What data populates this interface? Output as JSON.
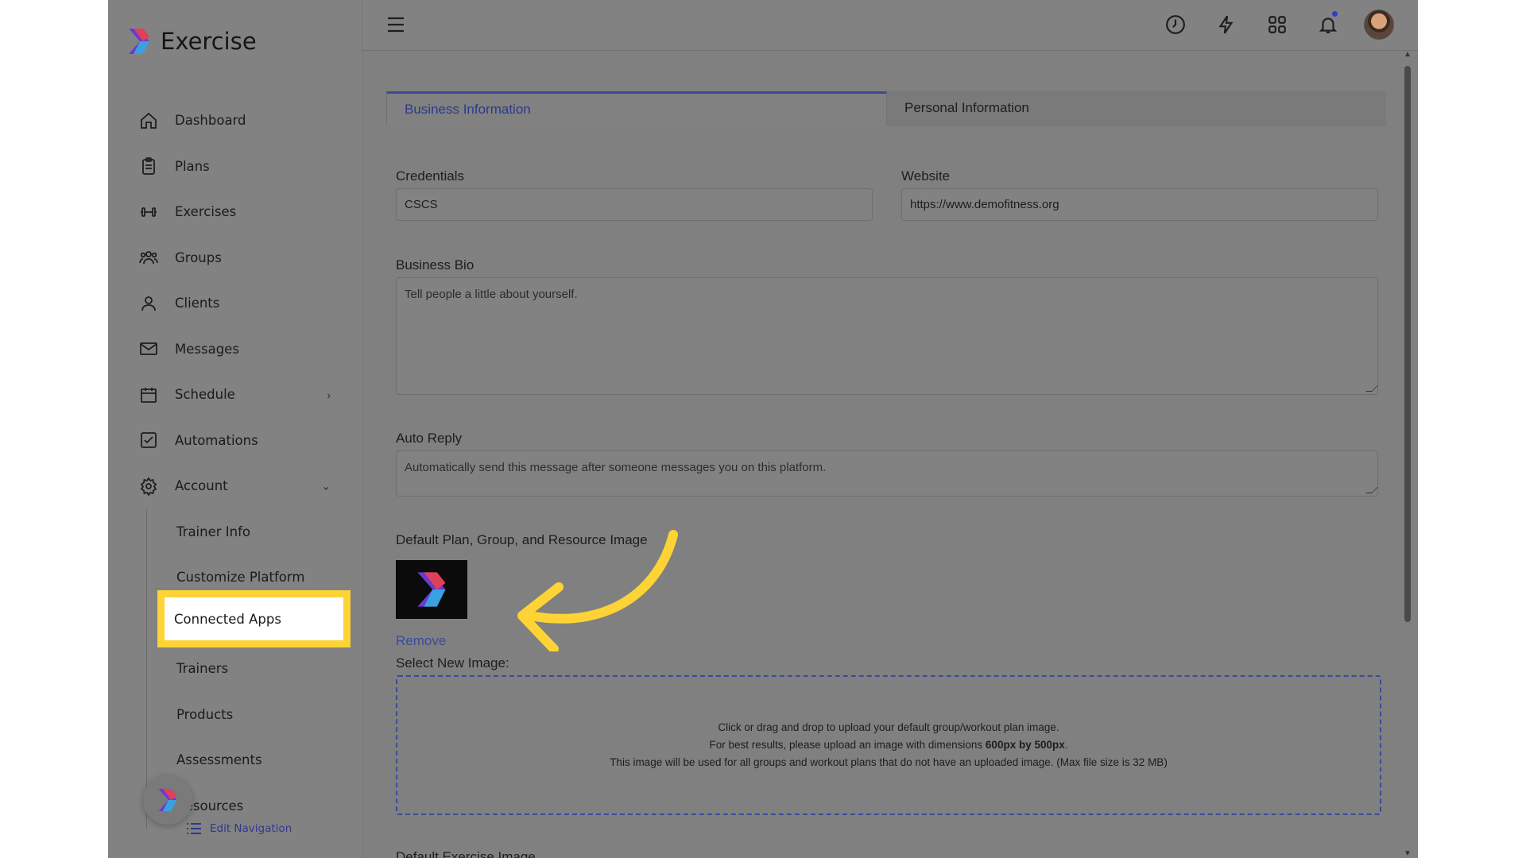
{
  "app": {
    "name": "Exercise"
  },
  "sidebar": {
    "items": [
      {
        "label": "Dashboard",
        "icon": "home-icon"
      },
      {
        "label": "Plans",
        "icon": "clipboard-icon"
      },
      {
        "label": "Exercises",
        "icon": "dumbbell-icon"
      },
      {
        "label": "Groups",
        "icon": "groups-icon"
      },
      {
        "label": "Clients",
        "icon": "user-icon"
      },
      {
        "label": "Messages",
        "icon": "mail-icon"
      },
      {
        "label": "Schedule",
        "icon": "calendar-icon",
        "chevron": "›"
      },
      {
        "label": "Automations",
        "icon": "checkbox-icon"
      },
      {
        "label": "Account",
        "icon": "gear-icon",
        "chevron": "⌄"
      }
    ],
    "account_sub": [
      {
        "label": "Trainer Info"
      },
      {
        "label": "Customize Platform"
      },
      {
        "label": "Connected Apps"
      },
      {
        "label": "Trainers"
      },
      {
        "label": "Products"
      },
      {
        "label": "Assessments"
      },
      {
        "label": "Resources"
      }
    ],
    "edit_navigation": "Edit Navigation"
  },
  "tabs": [
    {
      "label": "Business Information",
      "active": true
    },
    {
      "label": "Personal Information",
      "active": false
    }
  ],
  "form": {
    "credentials": {
      "label": "Credentials",
      "value": "CSCS"
    },
    "website": {
      "label": "Website",
      "value": "https://www.demofitness.org"
    },
    "bio": {
      "label": "Business Bio",
      "placeholder": "Tell people a little about yourself."
    },
    "auto_reply": {
      "label": "Auto Reply",
      "placeholder": "Automatically send this message after someone messages you on this platform."
    },
    "default_image": {
      "label": "Default Plan, Group, and Resource Image",
      "remove": "Remove",
      "select_new": "Select New Image:",
      "drop_line1": "Click or drag and drop to upload your default group/workout plan image.",
      "drop_line2_pre": "For best results, please upload an image with dimensions ",
      "drop_line2_bold": "600px by 500px",
      "drop_line2_post": ".",
      "drop_line3": "This image will be used for all groups and workout plans that do not have an uploaded image. (Max file size is 32 MB)"
    },
    "next_section_label": "Default Exercise Image"
  },
  "colors": {
    "overlay_gray": "#808080",
    "accent": "#3a4b9a",
    "highlight": "#fdd335"
  }
}
